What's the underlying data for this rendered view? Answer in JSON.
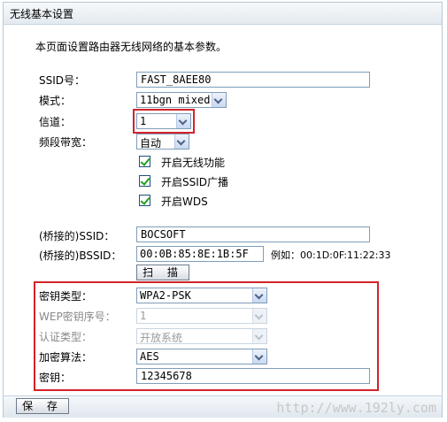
{
  "title": "无线基本设置",
  "description": "本页面设置路由器无线网络的基本参数。",
  "fields": {
    "ssid": {
      "label": "SSID号：",
      "value": "FAST_8AEE80"
    },
    "mode": {
      "label": "模式：",
      "value": "11bgn mixed"
    },
    "channel": {
      "label": "信道：",
      "value": "1"
    },
    "bandwidth": {
      "label": "频段带宽：",
      "value": "自动"
    }
  },
  "checkboxes": [
    {
      "label": "开启无线功能",
      "checked": true
    },
    {
      "label": "开启SSID广播",
      "checked": true
    },
    {
      "label": "开启WDS",
      "checked": true
    }
  ],
  "wds": {
    "bridged_ssid_label": "(桥接的)SSID：",
    "bridged_ssid_value": "BOCSOFT",
    "bridged_bssid_label": "(桥接的)BSSID：",
    "bridged_bssid_value": "00:0B:85:8E:1B:5F",
    "example": "例如：00:1D:0F:11:22:33",
    "scan_button": "扫 描"
  },
  "security": {
    "key_type_label": "密钥类型：",
    "key_type_value": "WPA2-PSK",
    "wep_index_label": "WEP密钥序号：",
    "wep_index_value": "1",
    "auth_type_label": "认证类型：",
    "auth_type_value": "开放系统",
    "cipher_label": "加密算法：",
    "cipher_value": "AES",
    "key_label": "密钥：",
    "key_value": "12345678"
  },
  "save_button": "保 存",
  "watermark": "http://www.192ly.com",
  "colors": {
    "highlight": "#d2232a",
    "check": "#21a121",
    "border": "#7f9db9"
  }
}
